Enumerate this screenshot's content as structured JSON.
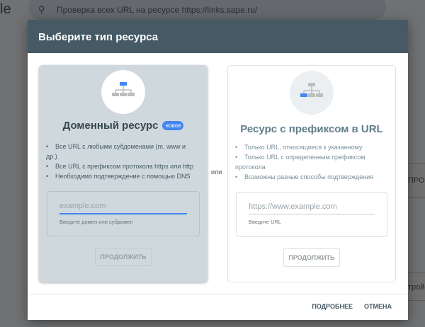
{
  "background": {
    "logo_fragment": "le",
    "search_text": "Проверка всех URL на ресурсе https://links.sape.ru/",
    "side_fragments": [
      "ПРОС",
      "тройс"
    ]
  },
  "dialog": {
    "title": "Выберите тип ресурса",
    "or_label": "или",
    "domain": {
      "title": "Доменный ресурс",
      "badge": "новое",
      "bullets": [
        "Все URL с любыми субдоменами (m, www и др.)",
        "Все URL с префиксом протокола https или http",
        "Необходимо подтверждение с помощью DNS"
      ],
      "placeholder": "example.com",
      "hint": "Введите домен или субдомен",
      "button": "ПРОДОЛЖИТЬ"
    },
    "prefix": {
      "title": "Ресурс с префиксом в URL",
      "bullets": [
        "Только URL, относящиеся к указанному",
        "Только URL с определенным префиксом протокола",
        "Возможны разные способы подтверждения"
      ],
      "placeholder": "https://www.example.com",
      "hint": "Введите URL",
      "button": "ПРОДОЛЖИТЬ"
    },
    "footer": {
      "learn_more": "ПОДРОБНЕЕ",
      "cancel": "ОТМЕНА"
    }
  },
  "colors": {
    "header": "#455a64",
    "accent": "#4285f4",
    "selected_card": "#cfd8dc"
  }
}
